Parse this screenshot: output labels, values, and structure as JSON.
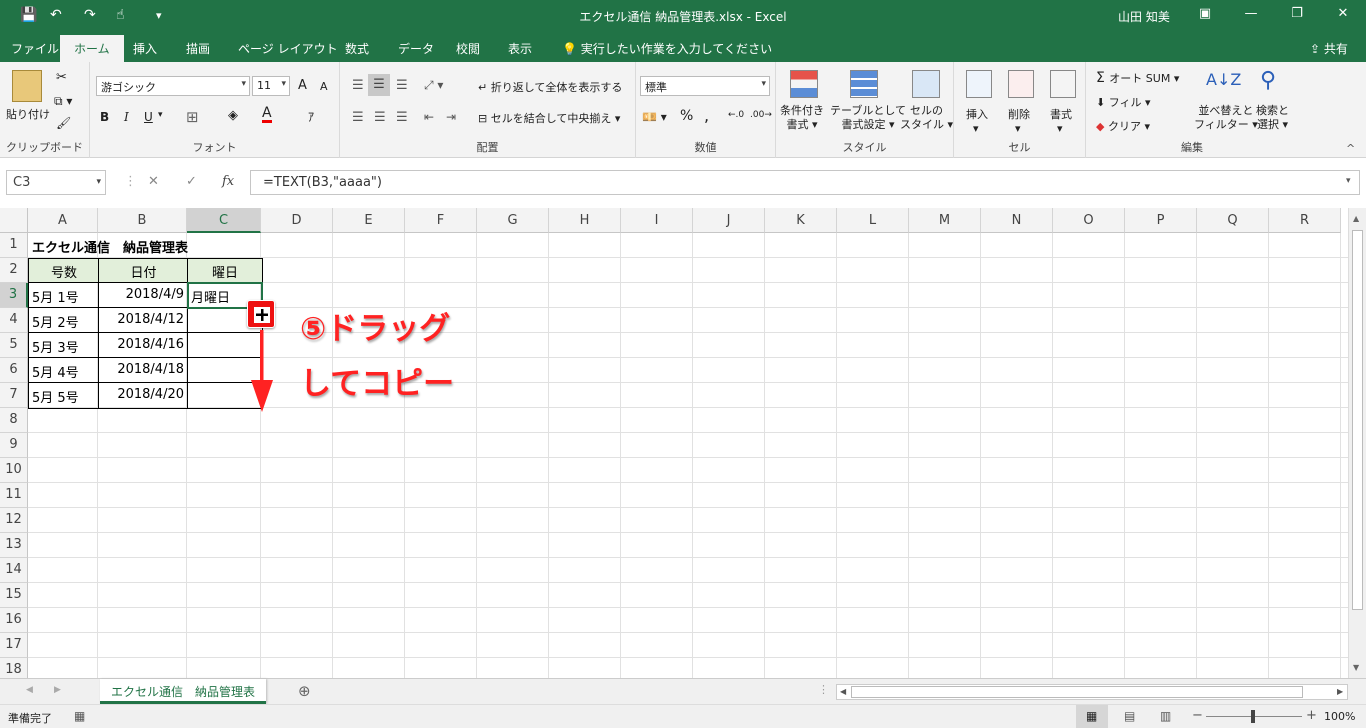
{
  "window": {
    "title": "エクセル通信 納品管理表.xlsx  -  Excel",
    "user": "山田 知美",
    "min": "—",
    "max": "❐",
    "close": "✕",
    "ribbon_opts": "▣"
  },
  "qa": {
    "save": "💾",
    "undo": "↶",
    "redo": "↷",
    "touch": "☝",
    "more": "▾"
  },
  "tabs": [
    "ファイル",
    "ホーム",
    "挿入",
    "描画",
    "ページ レイアウト",
    "数式",
    "データ",
    "校閲",
    "表示"
  ],
  "tell_me": "実行したい作業を入力してください",
  "share": "共有",
  "clipboard": {
    "paste": "貼り付け",
    "label": "クリップボード"
  },
  "font": {
    "name": "游ゴシック",
    "size": "11",
    "label": "フォント",
    "bold": "B",
    "italic": "I",
    "underline": "U",
    "grow": "A",
    "shrink": "A"
  },
  "align": {
    "wrap": "折り返して全体を表示する",
    "merge": "セルを結合して中央揃え",
    "label": "配置"
  },
  "number": {
    "format": "標準",
    "label": "数値",
    "percent": "%",
    "comma": ","
  },
  "styles": {
    "cond": [
      "条件付き",
      "書式"
    ],
    "table": [
      "テーブルとして",
      "書式設定"
    ],
    "cell": [
      "セルの",
      "スタイル"
    ],
    "label": "スタイル"
  },
  "cells": {
    "insert": "挿入",
    "delete": "削除",
    "format": "書式",
    "label": "セル"
  },
  "edit": {
    "autosum": "オート SUM",
    "fill": "フィル",
    "clear": "クリア",
    "sort": [
      "並べ替えと",
      "フィルター"
    ],
    "find": [
      "検索と",
      "選択"
    ],
    "label": "編集"
  },
  "formula_bar": {
    "name_box": "C3",
    "formula": "=TEXT(B3,\"aaaa\")",
    "cancel": "✕",
    "enter": "✓",
    "fx": "fx"
  },
  "columns": [
    "A",
    "B",
    "C",
    "D",
    "E",
    "F",
    "G",
    "H",
    "I",
    "J",
    "K",
    "L",
    "M",
    "N",
    "O",
    "P",
    "Q",
    "R"
  ],
  "rows": [
    "1",
    "2",
    "3",
    "4",
    "5",
    "6",
    "7",
    "8",
    "9",
    "10",
    "11",
    "12",
    "13",
    "14",
    "15",
    "16",
    "17",
    "18"
  ],
  "sheet": {
    "title": "エクセル通信　納品管理表",
    "headers": [
      "号数",
      "日付",
      "曜日"
    ],
    "data": [
      [
        "5月 1号",
        "2018/4/9",
        "月曜日"
      ],
      [
        "5月 2号",
        "2018/4/12",
        ""
      ],
      [
        "5月 3号",
        "2018/4/16",
        ""
      ],
      [
        "5月 4号",
        "2018/4/18",
        ""
      ],
      [
        "5月 5号",
        "2018/4/20",
        ""
      ]
    ]
  },
  "annotation": {
    "line1": "⑤ドラッグ",
    "line2": "してコピー"
  },
  "sheet_tab": "エクセル通信　納品管理表",
  "status": {
    "ready": "準備完了",
    "zoom": "100%"
  },
  "colors": {
    "accent": "#217346",
    "header_fill": "#e2efda",
    "annotation": "#ff2222"
  }
}
